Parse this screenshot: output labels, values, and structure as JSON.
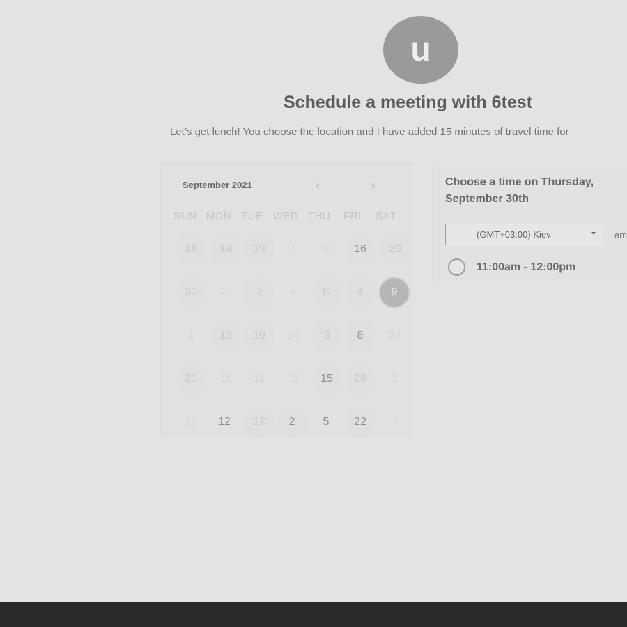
{
  "avatar": {
    "initial": "u"
  },
  "header": {
    "title": "Schedule a meeting with 6test",
    "subtitle": "Let’s get lunch! You choose the location and I have added 15 minutes of travel time for"
  },
  "calendar": {
    "month_label": "September 2021",
    "prev_icon": "‹",
    "next_icon": "›",
    "weekdays": [
      "SUN",
      "MON",
      "TUE",
      "WED",
      "THU",
      "FRI",
      "SAT"
    ],
    "rows": [
      [
        "18",
        "14",
        "19",
        "1",
        "30",
        "16",
        "20"
      ],
      [
        "30",
        "27",
        "7",
        "8",
        "11",
        "4",
        "9"
      ],
      [
        "1",
        "13",
        "10",
        "24",
        "3",
        "8",
        "24"
      ],
      [
        "21",
        "15",
        "11",
        "11",
        "15",
        "28",
        "2"
      ],
      [
        "18",
        "12",
        "17",
        "2",
        "5",
        "22",
        "7"
      ]
    ],
    "selected_day": "9"
  },
  "panel": {
    "title": "Choose a time on Thursday, September 30th",
    "timezone": "(GMT+03:00) Kiev",
    "ampm_label": "am",
    "slots": [
      "11:00am - 12:00pm"
    ]
  }
}
